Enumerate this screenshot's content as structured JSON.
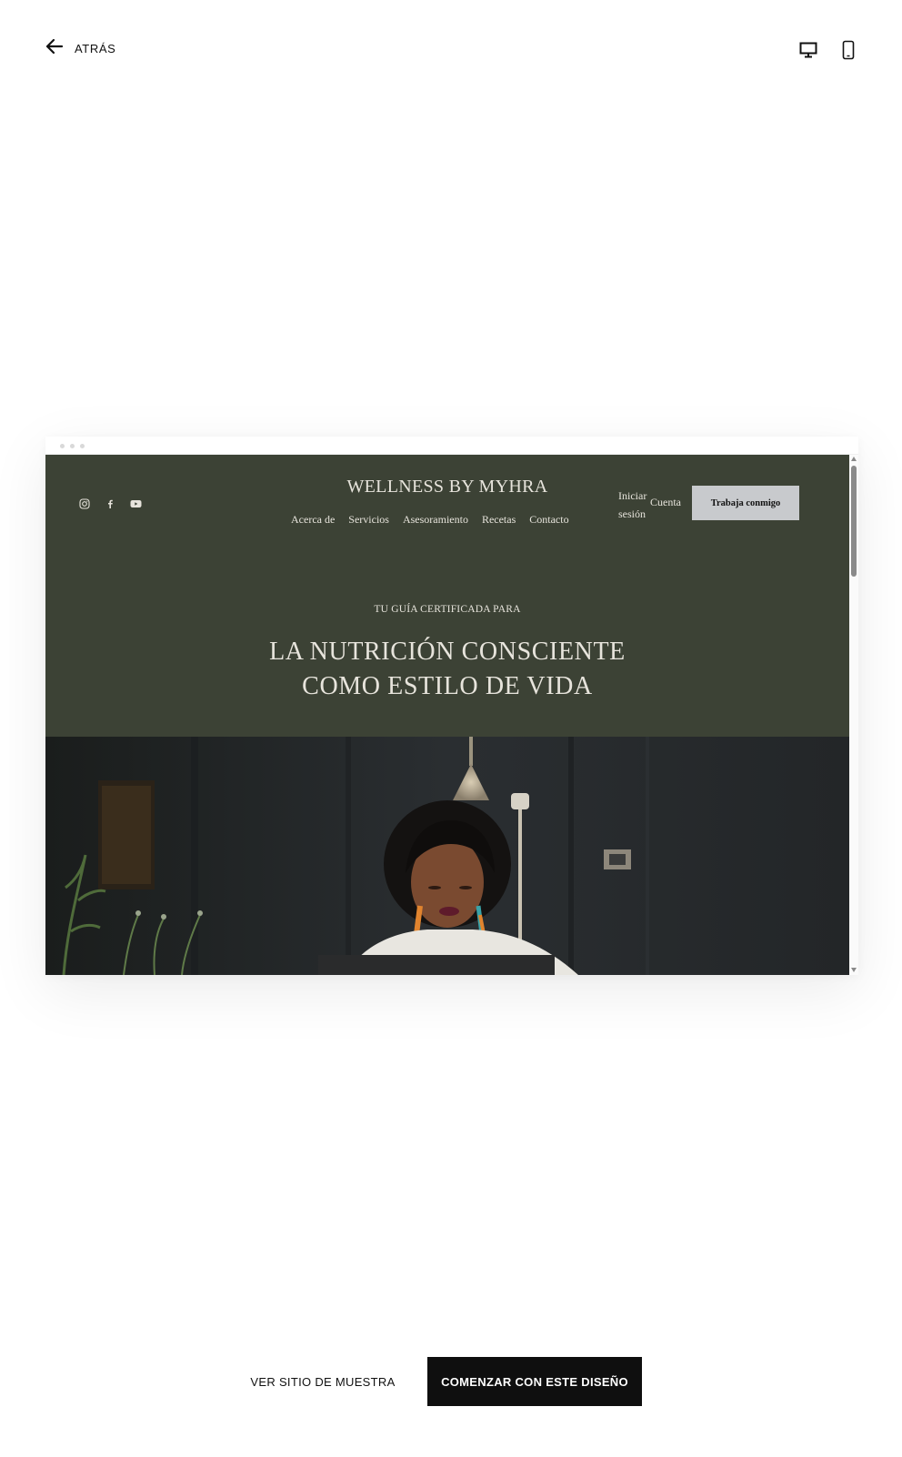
{
  "topbar": {
    "back_label": "ATRÁS",
    "devices": [
      "desktop",
      "mobile"
    ],
    "selected_device": "desktop"
  },
  "preview": {
    "site": {
      "brand": "WELLNESS BY MYHRA",
      "social_icons": [
        "instagram-icon",
        "facebook-icon",
        "youtube-icon"
      ],
      "nav": [
        "Acerca de",
        "Servicios",
        "Asesoramiento",
        "Recetas",
        "Contacto"
      ],
      "login_label": "Iniciar sesión",
      "account_label": "Cuenta",
      "cta_label": "Trabaja conmigo",
      "eyebrow": "TU GUÍA CERTIFICADA PARA",
      "headline_line1": "LA NUTRICIÓN CONSCIENTE",
      "headline_line2": "COMO ESTILO DE VIDA"
    },
    "colors": {
      "header_bg": "#3c4235",
      "header_text": "#e7e4dc",
      "cta_bg": "#c8cacd"
    }
  },
  "actions": {
    "sample_label": "VER SITIO DE MUESTRA",
    "start_label": "COMENZAR CON ESTE DISEÑO"
  }
}
